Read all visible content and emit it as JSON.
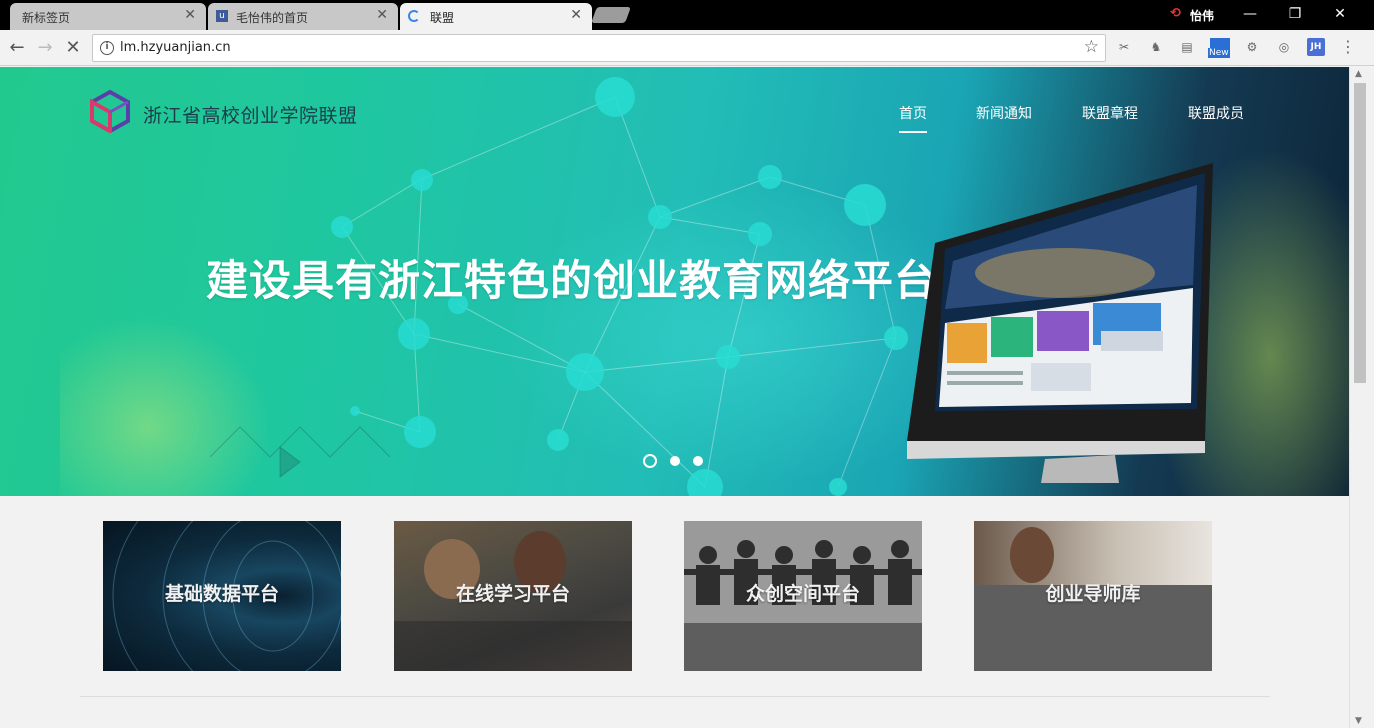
{
  "browser": {
    "tabs": [
      {
        "title": "新标签页",
        "close": "✕"
      },
      {
        "title": "毛怡伟的首页",
        "close": "✕"
      },
      {
        "title": "联盟",
        "close": "✕"
      }
    ],
    "user": "怡伟",
    "window_controls": {
      "minimize": "—",
      "restore": "❐",
      "close": "✕"
    },
    "url": "lm.hzyuanjian.cn",
    "extensions": [
      "clipper-icon",
      "evernote-icon",
      "reader-icon",
      "new-badge-icon",
      "puzzle-icon",
      "settings-icon",
      "jh-icon",
      "menu-icon"
    ],
    "new_badge": "New",
    "jh_label": "JH"
  },
  "site": {
    "name": "浙江省高校创业学院联盟",
    "nav": [
      {
        "label": "首页",
        "active": true
      },
      {
        "label": "新闻通知",
        "active": false
      },
      {
        "label": "联盟章程",
        "active": false
      },
      {
        "label": "联盟成员",
        "active": false
      }
    ],
    "slogan": "建设具有浙江特色的创业教育网络平台",
    "carousel": {
      "slides": 3,
      "active_index": 0
    },
    "platforms": [
      {
        "label": "基础数据平台"
      },
      {
        "label": "在线学习平台"
      },
      {
        "label": "众创空间平台"
      },
      {
        "label": "创业导师库"
      }
    ]
  },
  "colors": {
    "hero_green": "#22c98e",
    "hero_teal": "#1aa5b4",
    "hero_dark": "#0c2235",
    "nav_text": "#ffffff"
  }
}
